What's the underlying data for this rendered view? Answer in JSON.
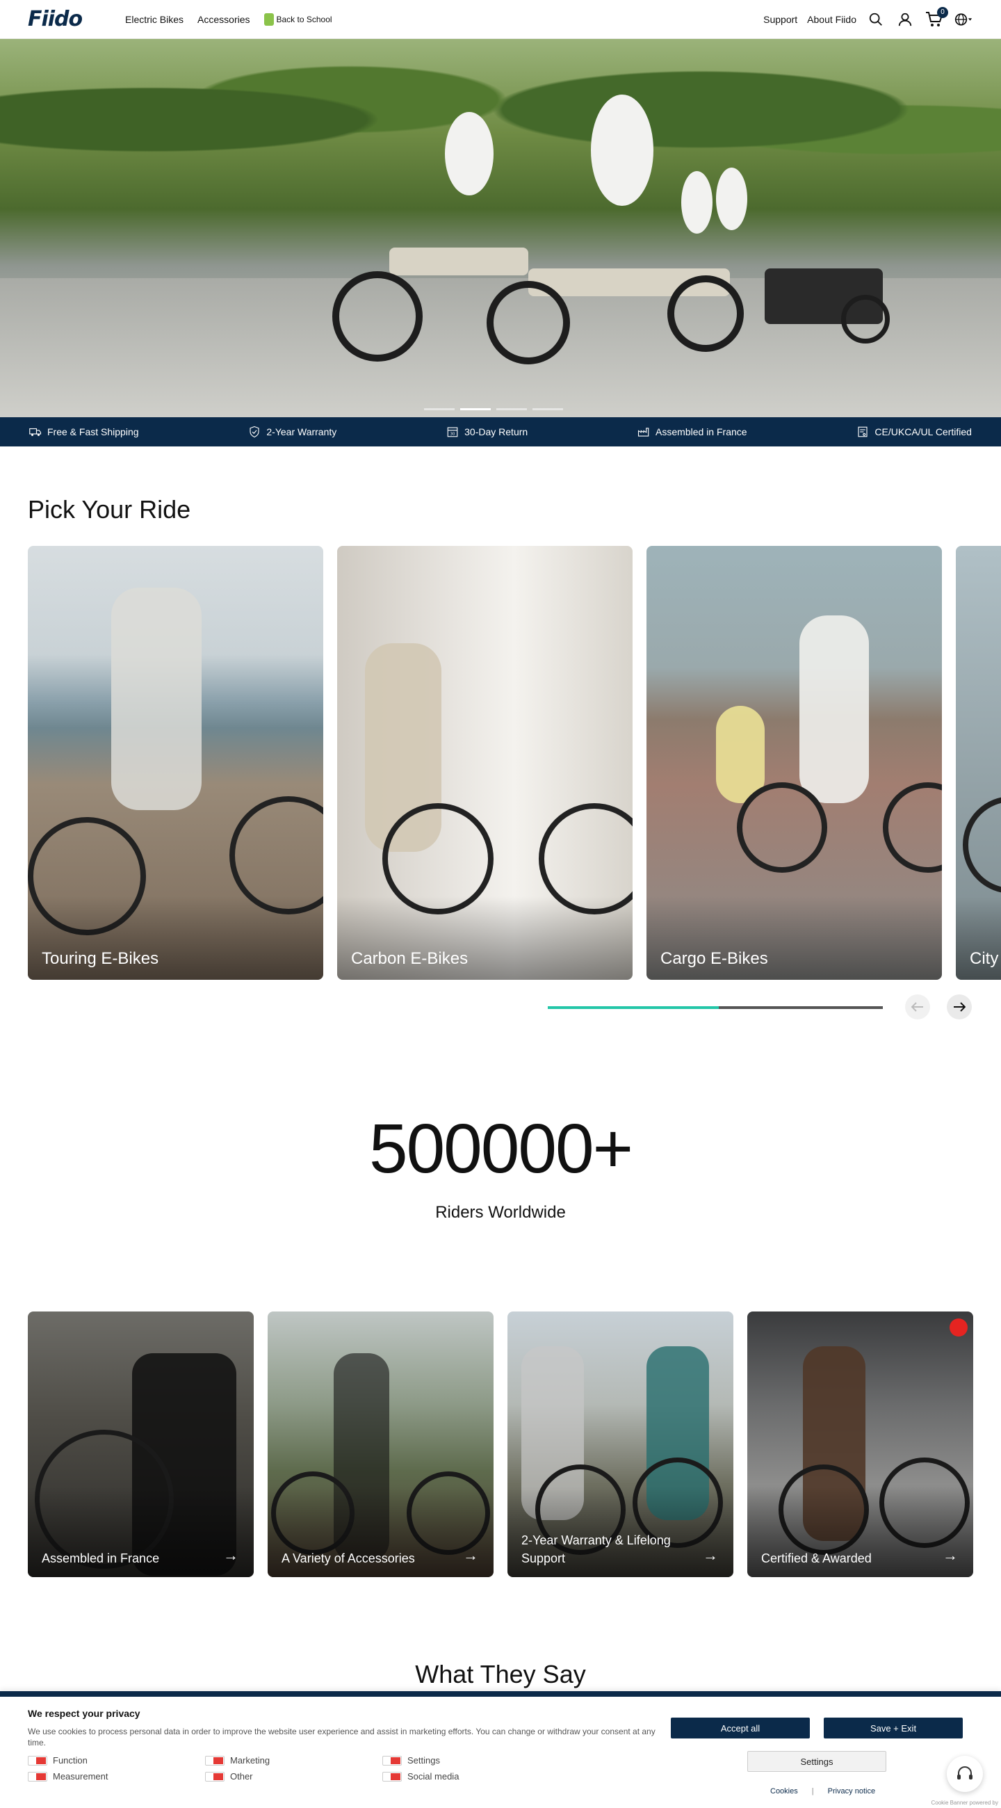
{
  "header": {
    "logo": "Fiido",
    "nav_left": [
      "Electric Bikes",
      "Accessories"
    ],
    "back_to_school": "Back to School",
    "nav_right": [
      "Support",
      "About Fiido"
    ],
    "cart_count": "0",
    "icons": [
      "search-icon",
      "account-icon",
      "cart-icon",
      "globe-icon"
    ]
  },
  "hero": {
    "slides": 4,
    "active_slide": 2
  },
  "features": [
    {
      "icon": "truck-icon",
      "label": "Free & Fast Shipping"
    },
    {
      "icon": "shield-icon",
      "label": "2-Year Warranty"
    },
    {
      "icon": "calendar-icon",
      "label": "30-Day Return"
    },
    {
      "icon": "factory-icon",
      "label": "Assembled in France"
    },
    {
      "icon": "certificate-icon",
      "label": "CE/UKCA/UL Certified"
    }
  ],
  "pick_your_ride": {
    "title": "Pick Your Ride",
    "cards": [
      {
        "label": "Touring E-Bikes"
      },
      {
        "label": "Carbon E-Bikes"
      },
      {
        "label": "Cargo E-Bikes"
      },
      {
        "label": "City"
      }
    ],
    "scroll_progress": 0.51
  },
  "stat": {
    "number": "500000+",
    "label": "Riders Worldwide"
  },
  "values": [
    {
      "label": "Assembled in France"
    },
    {
      "label": "A Variety of Accessories"
    },
    {
      "label": "2-Year Warranty & Lifelong Support"
    },
    {
      "label": "Certified & Awarded"
    }
  ],
  "testimonials": {
    "title": "What They Say"
  },
  "cookie": {
    "title": "We respect your privacy",
    "text": "We use cookies to process personal data in order to improve the website user experience and assist in marketing efforts. You can change or withdraw your consent at any time.",
    "toggles": [
      "Function",
      "Marketing",
      "Settings",
      "Measurement",
      "Other",
      "Social media"
    ],
    "accept_all": "Accept all",
    "save_exit": "Save + Exit",
    "settings": "Settings",
    "links": [
      "Cookies",
      "Privacy notice"
    ],
    "powered": "Cookie Banner powered by"
  },
  "colors": {
    "navy": "#0b2a4a",
    "accent": "#23c6a8",
    "toggle_off": "#e53935"
  }
}
